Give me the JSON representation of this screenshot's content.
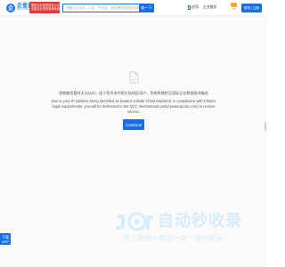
{
  "header": {
    "logo_mark": "企",
    "logo_cn": "企查查",
    "logo_en": "QCC.COM",
    "badge_line1": "国家企业信用信息公示系统",
    "badge_line2": "全国企业信用查询系统",
    "search_placeholder": "请输入企业名、人名、产品名、地址等信息或电话邮箱查询",
    "search_button": "查一下",
    "nav_app": "应用",
    "nav_business": "企业服务",
    "vip_label": "VIP",
    "login_button": "登录 | 注册"
  },
  "notice": {
    "icon": "document-icon",
    "message_cn": "很抱歉您暂时无法访问，由于您为非中国大陆地区用户，系统将跳转至国际企业数据查询服务",
    "message_en": "Due to your IP address being identified as located outside China Mainland, in compliance with China's legal requirements, you will be redirected to the QCC International portal (www.qcciip.com) to receive service.",
    "continue_button": "Continue"
  },
  "side": {
    "app_tab_line1": "下载",
    "app_tab_line2": "APP"
  },
  "watermark": {
    "title": "自动秒收录",
    "subtitle": "放上链接一来访一次一自动收录一"
  },
  "colors": {
    "primary": "#1a6fe0",
    "badge_red": "#e23a34",
    "vip_gold": "#f5a623",
    "watermark": "#d5ecfa"
  }
}
